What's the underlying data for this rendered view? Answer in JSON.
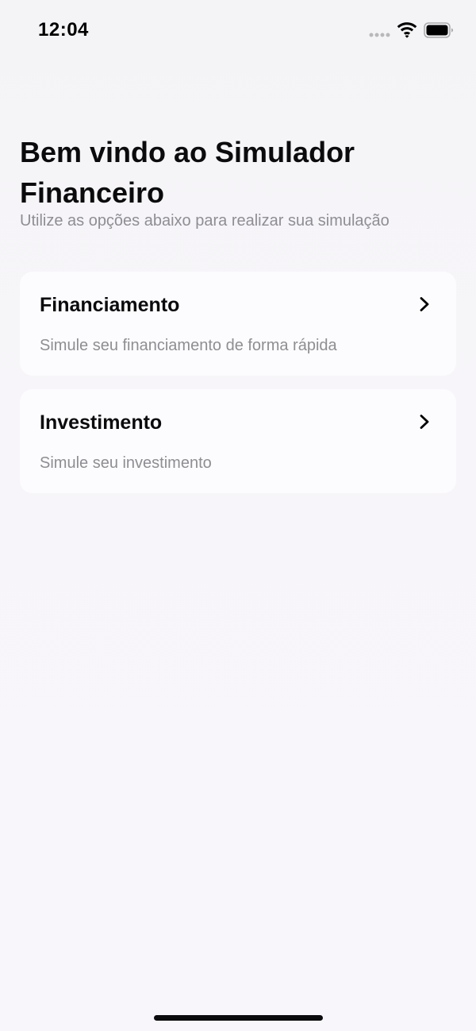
{
  "status_bar": {
    "time": "12:04",
    "signal_icon": "cellular-signal-dots-icon",
    "wifi_icon": "wifi-icon",
    "battery_icon": "battery-icon"
  },
  "header": {
    "title": "Bem vindo ao Simulador Financeiro",
    "subtitle": "Utilize as opções abaixo para realizar sua simulação"
  },
  "options": [
    {
      "title": "Financiamento",
      "description": "Simule seu financiamento de forma rápida",
      "icon": "chevron-right-icon"
    },
    {
      "title": "Investimento",
      "description": "Simule seu investimento",
      "icon": "chevron-right-icon"
    }
  ],
  "colors": {
    "background": "#f7f5f9",
    "card": "#fcfbfd",
    "text_primary": "#0b0b0d",
    "text_secondary": "#8e8e93"
  }
}
